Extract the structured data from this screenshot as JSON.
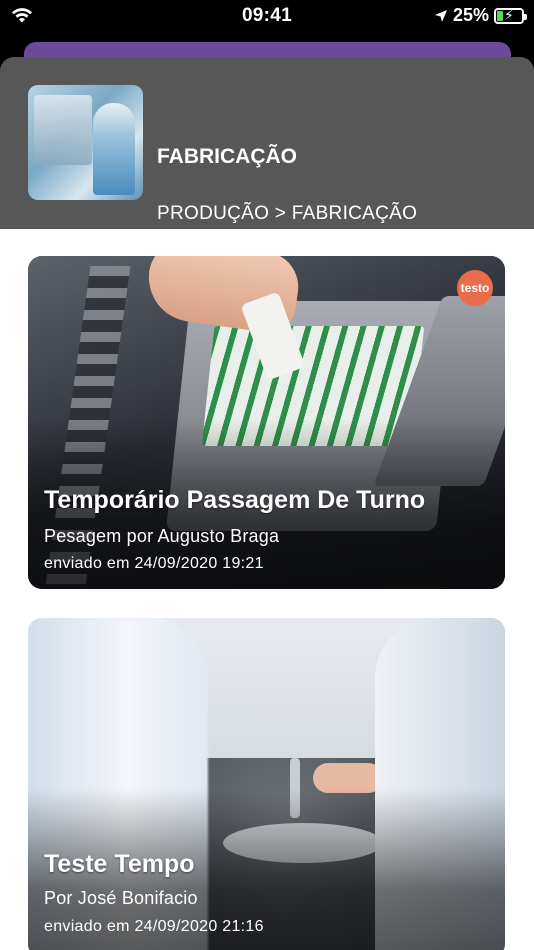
{
  "status_bar": {
    "time": "09:41",
    "battery_percent": "25%",
    "battery_level": 0.25,
    "icons": [
      "wifi-icon",
      "location-arrow-icon",
      "battery-charging-icon"
    ]
  },
  "header": {
    "title": "FABRICAÇÃO",
    "breadcrumb": "PRODUÇÃO > FABRICAÇÃO"
  },
  "cards": [
    {
      "title": "Temporário Passagem De Turno",
      "subtitle": "Pesagem por Augusto Braga",
      "date": "enviado em 24/09/2020 19:21",
      "logo_text": "testo"
    },
    {
      "title": "Teste Tempo",
      "subtitle": "Por José Bonifacio",
      "date": "enviado em 24/09/2020 21:16"
    }
  ],
  "colors": {
    "accent_purple": "#6b4a99",
    "header_bg": "#575757",
    "battery_green": "#4cd964"
  }
}
